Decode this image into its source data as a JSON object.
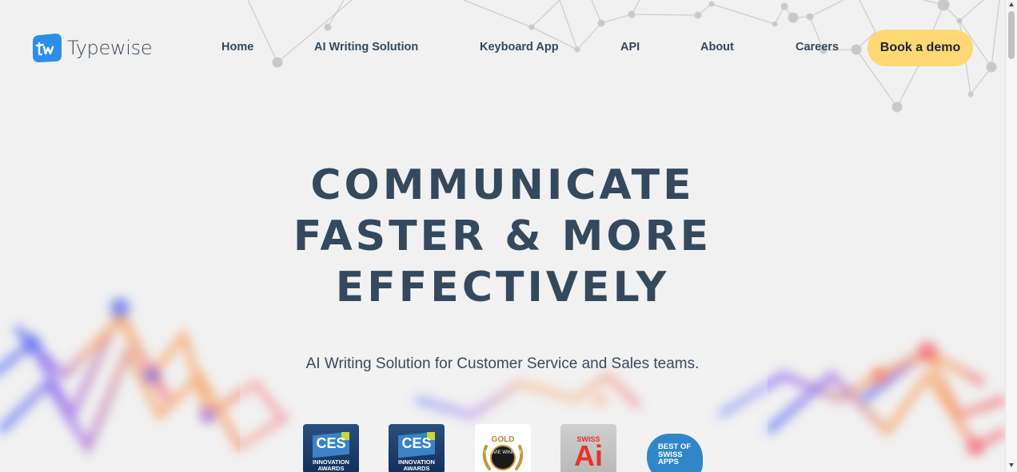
{
  "brand": {
    "name": "Typewise",
    "accent": "#2c8ee8"
  },
  "nav": {
    "items": [
      {
        "label": "Home"
      },
      {
        "label": "AI Writing Solution"
      },
      {
        "label": "Keyboard App"
      },
      {
        "label": "API"
      },
      {
        "label": "About"
      },
      {
        "label": "Careers"
      }
    ],
    "cta": {
      "label": "Book a demo",
      "color": "#ffd873"
    }
  },
  "hero": {
    "title_lines": [
      "COMMUNICATE",
      "FASTER & MORE",
      "EFFECTIVELY"
    ],
    "subtitle": "AI Writing Solution for Customer Service and Sales teams."
  },
  "badges": [
    {
      "name": "ces-innovation-awards",
      "logo": "CES",
      "caption": "INNOVATION AWARDS"
    },
    {
      "name": "ces-innovation-awards",
      "logo": "CES",
      "caption": "INNOVATION AWARDS"
    },
    {
      "name": "gold-stevie-winner",
      "top": "GOLD",
      "caption": "STEVIE WINNER"
    },
    {
      "name": "swiss-ai-award",
      "top": "SWISS",
      "logo": "Ai"
    },
    {
      "name": "best-of-swiss-apps",
      "caption": "BEST OF SWISS APPS"
    }
  ],
  "colors": {
    "heading": "#34495e",
    "background": "#f1f1f1",
    "network_blue": "#4a6cf7",
    "network_orange": "#f7a66a",
    "network_pink": "#f0607a"
  }
}
